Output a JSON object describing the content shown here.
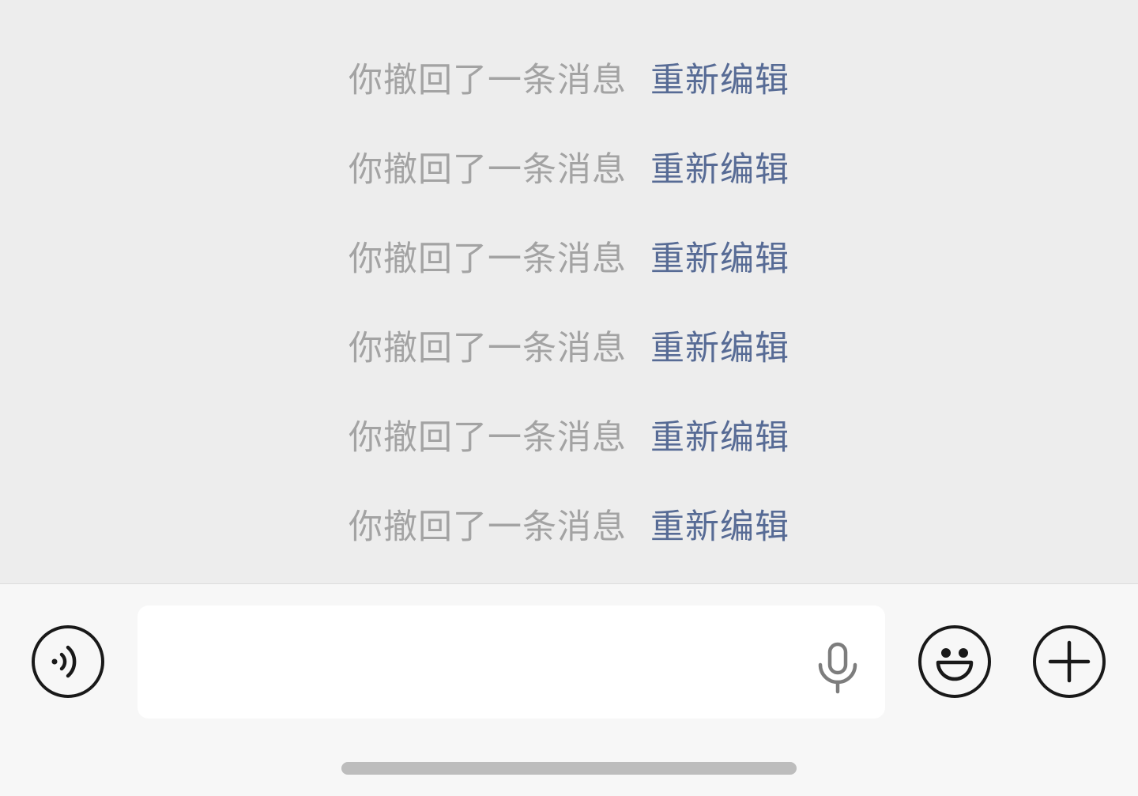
{
  "chat": {
    "messages": [
      {
        "recall_text": "你撤回了一条消息",
        "reedit_label": "重新编辑"
      },
      {
        "recall_text": "你撤回了一条消息",
        "reedit_label": "重新编辑"
      },
      {
        "recall_text": "你撤回了一条消息",
        "reedit_label": "重新编辑"
      },
      {
        "recall_text": "你撤回了一条消息",
        "reedit_label": "重新编辑"
      },
      {
        "recall_text": "你撤回了一条消息",
        "reedit_label": "重新编辑"
      },
      {
        "recall_text": "你撤回了一条消息",
        "reedit_label": "重新编辑"
      }
    ]
  },
  "input_bar": {
    "text_value": "",
    "voice_button_icon": "voice-icon",
    "mic_icon": "microphone-icon",
    "emoji_button_icon": "smiley-face-icon",
    "more_button_icon": "plus-icon"
  },
  "colors": {
    "chat_background": "#ededed",
    "input_bar_background": "#f7f7f7",
    "recall_text": "#a3a3a3",
    "link": "#576b95",
    "icon_stroke": "#191919"
  }
}
